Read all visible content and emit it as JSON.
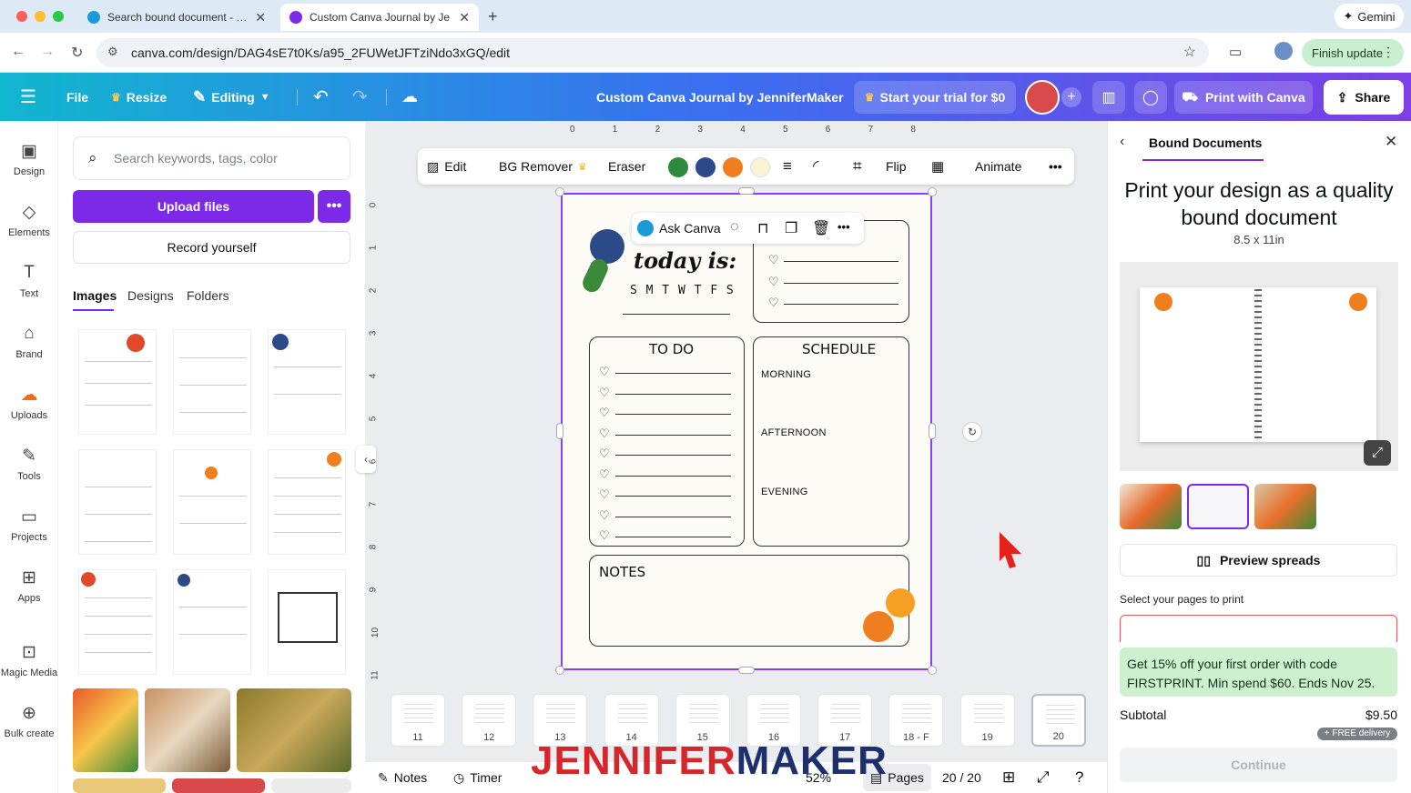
{
  "browser": {
    "tabs": [
      {
        "title": "Search bound document - Ca"
      },
      {
        "title": "Custom Canva Journal by Je"
      }
    ],
    "url": "canva.com/design/DAG4sE7t0Ks/a95_2FUWetJFTziNdo3xGQ/edit",
    "gemini_label": "Gemini",
    "finish_update_label": "Finish update"
  },
  "header": {
    "file_label": "File",
    "resize_label": "Resize",
    "editing_label": "Editing",
    "design_title": "Custom Canva Journal by JenniferMaker",
    "trial_label": "Start your trial for $0",
    "print_label": "Print with Canva",
    "share_label": "Share"
  },
  "rail": [
    {
      "label": "Design",
      "icon": "design-icon"
    },
    {
      "label": "Elements",
      "icon": "elements-icon"
    },
    {
      "label": "Text",
      "icon": "text-icon"
    },
    {
      "label": "Brand",
      "icon": "brand-icon"
    },
    {
      "label": "Uploads",
      "icon": "uploads-icon"
    },
    {
      "label": "Tools",
      "icon": "tools-icon"
    },
    {
      "label": "Projects",
      "icon": "projects-icon"
    },
    {
      "label": "Apps",
      "icon": "apps-icon"
    },
    {
      "label": "Magic Media",
      "icon": "magic-media-icon"
    },
    {
      "label": "Bulk create",
      "icon": "bulk-create-icon"
    }
  ],
  "panel": {
    "search_placeholder": "Search keywords, tags, color",
    "upload_label": "Upload files",
    "record_label": "Record yourself",
    "tabs": [
      "Images",
      "Designs",
      "Folders"
    ],
    "active_tab": "Images"
  },
  "context_toolbar": {
    "edit_label": "Edit",
    "bg_remover_label": "BG Remover",
    "eraser_label": "Eraser",
    "flip_label": "Flip",
    "animate_label": "Animate",
    "swatches": [
      "#2e8a3e",
      "#2c4a87",
      "#f07d1e",
      "#fbf3d6"
    ]
  },
  "ask_canva_label": "Ask Canva",
  "page_content": {
    "today_label": "today is:",
    "days": "S M T W T F S",
    "todo_title": "TO DO",
    "schedule_title": "SCHEDULE",
    "morning": "MORNING",
    "afternoon": "AFTERNOON",
    "evening": "EVENING",
    "notes_title": "NOTES"
  },
  "ruler": {
    "h": [
      "0",
      "1",
      "2",
      "3",
      "4",
      "5",
      "6",
      "7",
      "8"
    ],
    "v": [
      "0",
      "1",
      "2",
      "3",
      "4",
      "5",
      "6",
      "7",
      "8",
      "9",
      "10",
      "11"
    ]
  },
  "page_strip": [
    "11",
    "12",
    "13",
    "14",
    "15",
    "16",
    "17",
    "18 - F",
    "19",
    "20"
  ],
  "bottom_bar": {
    "notes_label": "Notes",
    "timer_label": "Timer",
    "zoom": "52%",
    "pages_label": "Pages",
    "page_count": "20 / 20"
  },
  "right_panel": {
    "title": "Bound Documents",
    "headline": "Print your design as a quality bound document",
    "size": "8.5 x 11in",
    "preview_spreads_label": "Preview spreads",
    "select_pages_label": "Select your pages to print",
    "promo": "Get 15% off your first order with code FIRSTPRINT. Min spend $60. Ends Nov 25.",
    "subtotal_label": "Subtotal",
    "subtotal_value": "$9.50",
    "free_delivery": "+ FREE delivery",
    "continue_label": "Continue"
  },
  "watermark": {
    "part1": "JENNIFER",
    "part2": "MAKER"
  },
  "colors": {
    "accent": "#7d2ae8",
    "header_start": "#11b6cf",
    "header_end": "#7b3fe4"
  }
}
